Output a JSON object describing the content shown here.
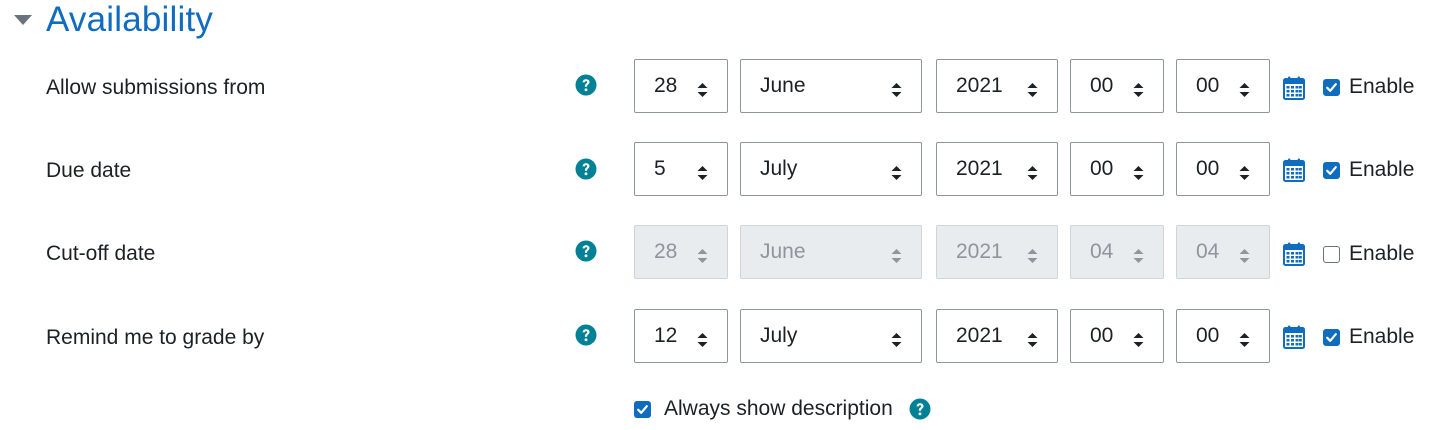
{
  "section": {
    "title": "Availability",
    "collapse_icon": "caret-down-icon"
  },
  "colors": {
    "accent": "#0f6cbf",
    "help": "#008196",
    "disabled_bg": "#e9ecef",
    "disabled_text": "#8f959e",
    "text": "#1d2125"
  },
  "rows": [
    {
      "label": "Allow submissions from",
      "day": "28",
      "month": "June",
      "year": "2021",
      "hour": "00",
      "minute": "00",
      "enable_label": "Enable",
      "enabled": true
    },
    {
      "label": "Due date",
      "day": "5",
      "month": "July",
      "year": "2021",
      "hour": "00",
      "minute": "00",
      "enable_label": "Enable",
      "enabled": true
    },
    {
      "label": "Cut-off date",
      "day": "28",
      "month": "June",
      "year": "2021",
      "hour": "04",
      "minute": "04",
      "enable_label": "Enable",
      "enabled": false
    },
    {
      "label": "Remind me to grade by",
      "day": "12",
      "month": "July",
      "year": "2021",
      "hour": "00",
      "minute": "00",
      "enable_label": "Enable",
      "enabled": true
    }
  ],
  "always_show": {
    "label": "Always show description",
    "checked": true
  },
  "icons": {
    "help": "question-circle-icon",
    "calendar": "calendar-icon",
    "select_arrows": "updown-arrows-icon"
  }
}
